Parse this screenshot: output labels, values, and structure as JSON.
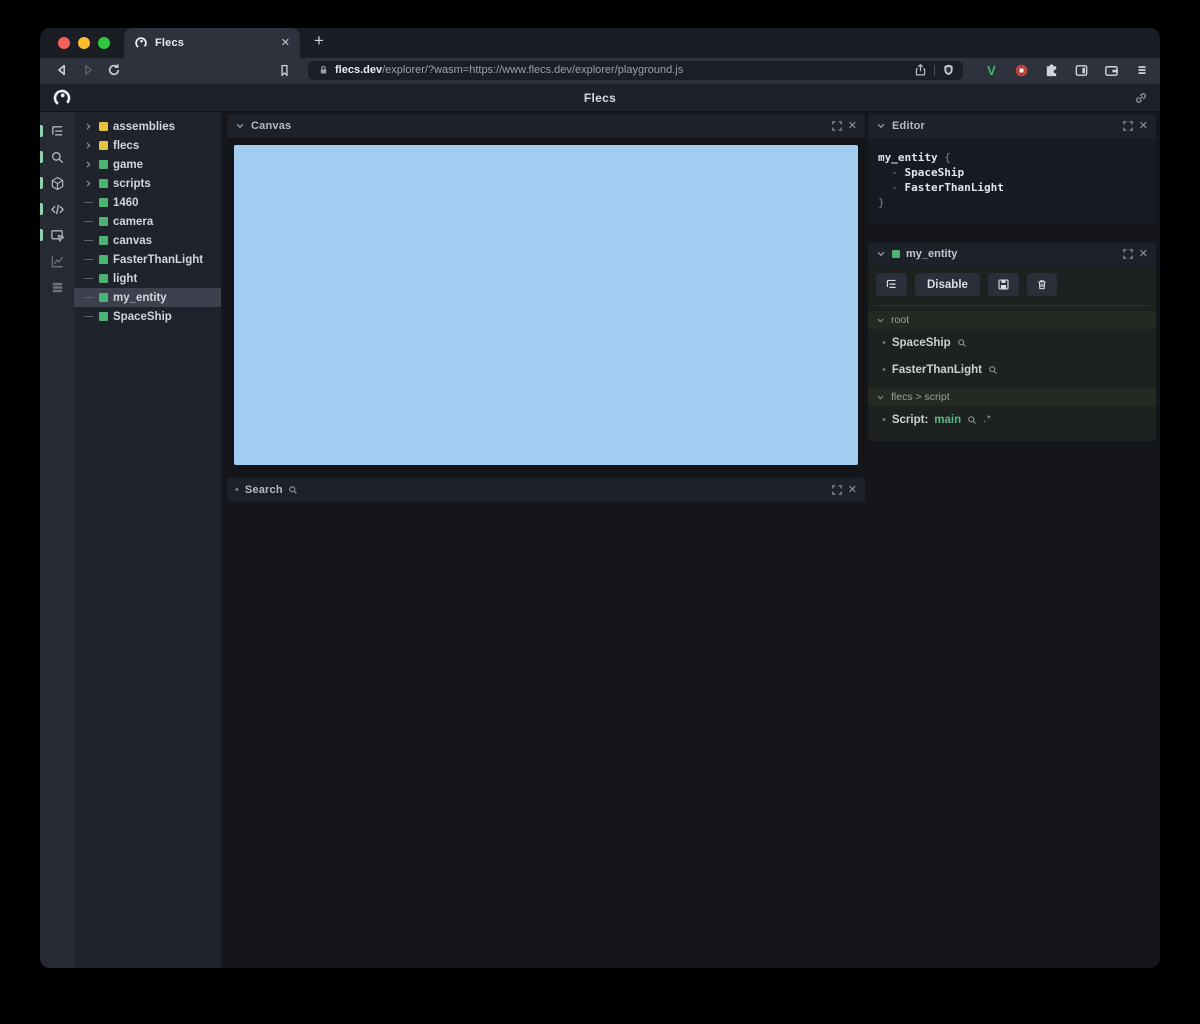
{
  "browser": {
    "tab": {
      "title": "Flecs",
      "close_glyph": "✕",
      "new_tab_glyph": "+"
    },
    "toolbar": {
      "url_host": "flecs.dev",
      "url_path": "/explorer/?wasm=https://www.flecs.dev/explorer/playground.js",
      "extension_v_label": "V"
    },
    "traffic_lights": {
      "red": "#f6605a",
      "yellow": "#fbbd2e",
      "green": "#2fc841"
    }
  },
  "app": {
    "header": {
      "title": "Flecs"
    },
    "sidebar_icons": [
      {
        "name": "tree-icon",
        "active": true
      },
      {
        "name": "search-icon",
        "active": true
      },
      {
        "name": "cube-icon",
        "active": true
      },
      {
        "name": "code-icon",
        "active": true
      },
      {
        "name": "canvas-select-icon",
        "active": true
      },
      {
        "name": "chart-icon",
        "active": false
      },
      {
        "name": "rows-icon",
        "active": false
      }
    ],
    "tree": {
      "items": [
        {
          "label": "assemblies",
          "type": "module",
          "expandable": true,
          "selected": false
        },
        {
          "label": "flecs",
          "type": "module",
          "expandable": true,
          "selected": false
        },
        {
          "label": "game",
          "type": "entity",
          "expandable": true,
          "selected": false
        },
        {
          "label": "scripts",
          "type": "entity",
          "expandable": true,
          "selected": false
        },
        {
          "label": "1460",
          "type": "entity",
          "expandable": false,
          "selected": false
        },
        {
          "label": "camera",
          "type": "entity",
          "expandable": false,
          "selected": false
        },
        {
          "label": "canvas",
          "type": "entity",
          "expandable": false,
          "selected": false
        },
        {
          "label": "FasterThanLight",
          "type": "entity",
          "expandable": false,
          "selected": false
        },
        {
          "label": "light",
          "type": "entity",
          "expandable": false,
          "selected": false
        },
        {
          "label": "my_entity",
          "type": "entity",
          "expandable": false,
          "selected": true
        },
        {
          "label": "SpaceShip",
          "type": "entity",
          "expandable": false,
          "selected": false
        }
      ]
    },
    "canvas_panel": {
      "title": "Canvas",
      "surface_color": "#a3ccf1"
    },
    "search_panel": {
      "title": "Search"
    },
    "editor_panel": {
      "title": "Editor",
      "code_lines": [
        [
          {
            "t": "my_entity",
            "c": "b"
          },
          {
            "t": " {",
            "c": "d"
          }
        ],
        [
          {
            "t": "  - ",
            "c": "d"
          },
          {
            "t": "SpaceShip",
            "c": "b"
          }
        ],
        [
          {
            "t": "  - ",
            "c": "d"
          },
          {
            "t": "FasterThanLight",
            "c": "b"
          }
        ],
        [
          {
            "t": "}",
            "c": "d"
          }
        ]
      ]
    },
    "inspector": {
      "title": "my_entity",
      "disable_label": "Disable",
      "sections": [
        {
          "title": "root",
          "items": [
            {
              "label": "SpaceShip",
              "value": "",
              "suffix": ""
            },
            {
              "label": "FasterThanLight",
              "value": "",
              "suffix": ""
            }
          ]
        },
        {
          "title": "flecs > script",
          "items": [
            {
              "label": "Script:",
              "value": "main",
              "suffix": ".*"
            }
          ]
        }
      ]
    }
  },
  "colors": {
    "accent_green": "#4db374",
    "module_yellow": "#e3c341",
    "canvas_blue": "#a3ccf1",
    "selection_gray": "#3c414d"
  }
}
